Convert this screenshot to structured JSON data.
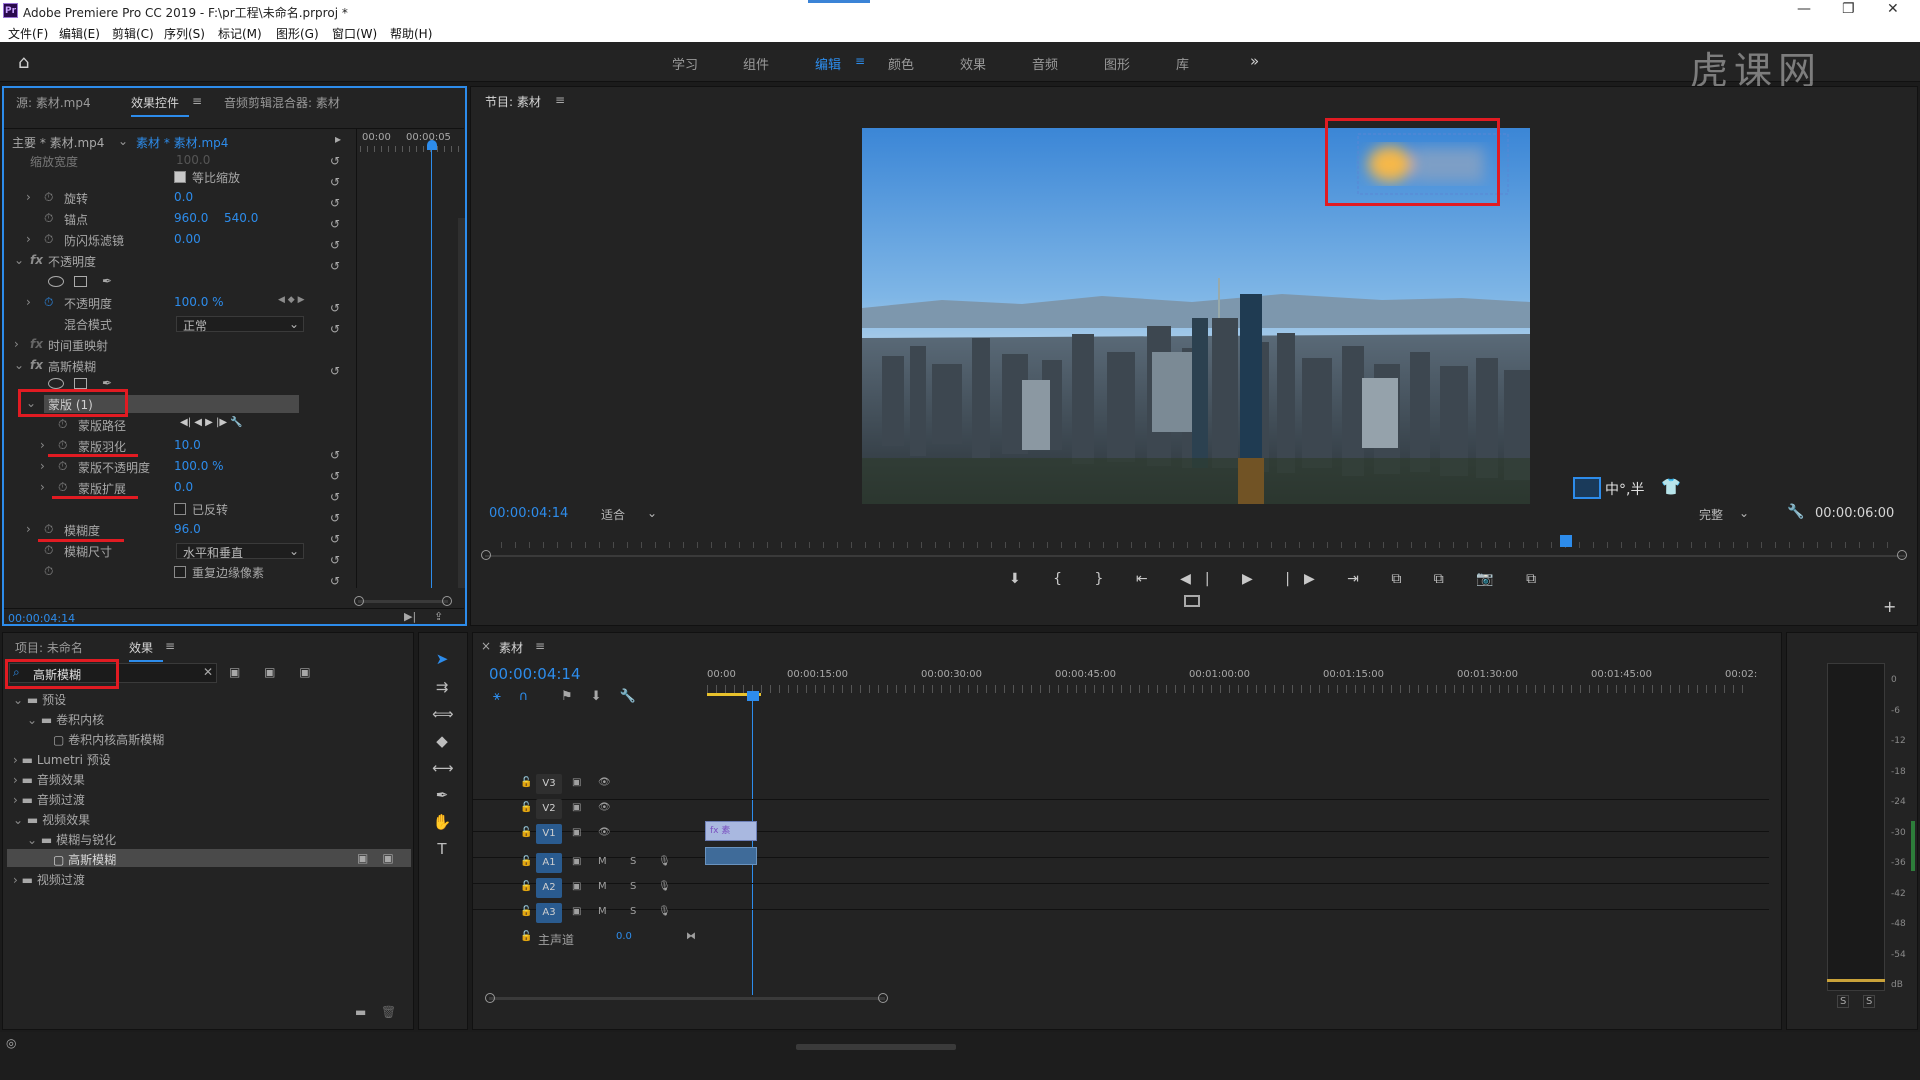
{
  "window": {
    "title": "Adobe Premiere Pro CC 2019 - F:\\pr工程\\未命名.prproj *",
    "app_icon": "Pr"
  },
  "menu": [
    "文件(F)",
    "编辑(E)",
    "剪辑(C)",
    "序列(S)",
    "标记(M)",
    "图形(G)",
    "窗口(W)",
    "帮助(H)"
  ],
  "workspaces": [
    "学习",
    "组件",
    "编辑",
    "颜色",
    "效果",
    "音频",
    "图形",
    "库"
  ],
  "watermark": "虎课网",
  "effect_controls": {
    "tabs": [
      "源: 素材.mp4",
      "效果控件",
      "音频剪辑混合器: 素材"
    ],
    "header_master": "主要 * 素材.mp4",
    "header_clip": "素材 * 素材.mp4",
    "ruler_start": "00:00",
    "ruler_mark": "00:00:05",
    "partial_row": "缩放宽度",
    "partial_val": "100.0",
    "uniform_scale": "等比缩放",
    "rotation": {
      "label": "旋转",
      "value": "0.0"
    },
    "anchor": {
      "label": "锚点",
      "x": "960.0",
      "y": "540.0"
    },
    "antiflicker": {
      "label": "防闪烁滤镜",
      "value": "0.00"
    },
    "opacity_section": "不透明度",
    "opacity": {
      "label": "不透明度",
      "value": "100.0 %"
    },
    "blend": {
      "label": "混合模式",
      "value": "正常"
    },
    "time_remap": "时间重映射",
    "gaussian": "高斯模糊",
    "mask": "蒙版 (1)",
    "mask_path": "蒙版路径",
    "mask_feather": {
      "label": "蒙版羽化",
      "value": "10.0"
    },
    "mask_opacity": {
      "label": "蒙版不透明度",
      "value": "100.0 %"
    },
    "mask_expansion": {
      "label": "蒙版扩展",
      "value": "0.0"
    },
    "inverted": "已反转",
    "blurriness": {
      "label": "模糊度",
      "value": "96.0"
    },
    "blur_dim": {
      "label": "模糊尺寸",
      "value": "水平和垂直"
    },
    "repeat_edge": "重复边缘像素",
    "timecode": "00:00:04:14"
  },
  "program": {
    "title": "节目: 素材",
    "timecode": "00:00:04:14",
    "fit": "适合",
    "quality": "完整",
    "duration": "00:00:06:00",
    "overlay_text": "中°,半"
  },
  "effects_panel": {
    "tabs": [
      "项目: 未命名",
      "效果"
    ],
    "search_value": "高斯模糊",
    "tree": [
      {
        "label": "预设",
        "level": 0,
        "open": true
      },
      {
        "label": "卷积内核",
        "level": 1,
        "open": true
      },
      {
        "label": "卷积内核高斯模糊",
        "level": 2
      },
      {
        "label": "Lumetri 预设",
        "level": 0
      },
      {
        "label": "音频效果",
        "level": 0
      },
      {
        "label": "音频过渡",
        "level": 0
      },
      {
        "label": "视频效果",
        "level": 0,
        "open": true
      },
      {
        "label": "模糊与锐化",
        "level": 1,
        "open": true
      },
      {
        "label": "高斯模糊",
        "level": 2,
        "selected": true
      },
      {
        "label": "视频过渡",
        "level": 0
      }
    ]
  },
  "timeline": {
    "title": "素材",
    "timecode": "00:00:04:14",
    "ruler": [
      "00:00",
      "00:00:15:00",
      "00:00:30:00",
      "00:00:45:00",
      "00:01:00:00",
      "00:01:15:00",
      "00:01:30:00",
      "00:01:45:00",
      "00:02:"
    ],
    "video_tracks": [
      "V3",
      "V2",
      "V1"
    ],
    "audio_tracks": [
      "A1",
      "A2",
      "A3"
    ],
    "master": {
      "label": "主声道",
      "value": "0.0"
    },
    "clip_label": "fx 素"
  },
  "meter_ticks": [
    "0",
    "-6",
    "-12",
    "-18",
    "-24",
    "-30",
    "-36",
    "-42",
    "-48",
    "-54",
    "dB"
  ],
  "meter_solo": [
    "S",
    "S"
  ]
}
